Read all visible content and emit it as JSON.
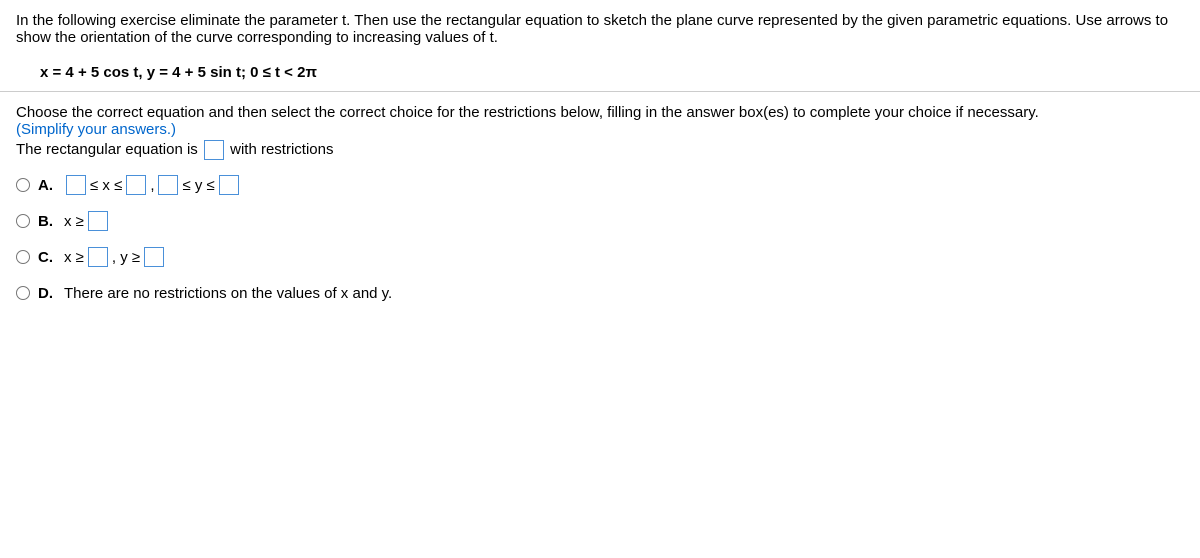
{
  "instructions": "In the following exercise eliminate the parameter t. Then use the rectangular equation to sketch the plane curve represented by the given parametric equations. Use arrows to show the orientation of the curve corresponding to increasing values of t.",
  "equation": "x = 4 + 5 cos t, y = 4 + 5 sin t; 0 ≤ t < 2π",
  "prompt": "Choose the correct equation and then select the correct choice for the restrictions below, filling in the answer box(es) to complete your choice if necessary.",
  "simplify_note": "(Simplify your answers.)",
  "rect_line_prefix": "The rectangular equation is",
  "rect_line_suffix": "with restrictions",
  "options": {
    "A": {
      "label": "A.",
      "parts": {
        "lexle": "≤ x ≤",
        "comma": ",",
        "leyle": "≤ y ≤"
      }
    },
    "B": {
      "label": "B.",
      "parts": {
        "xge": "x ≥"
      }
    },
    "C": {
      "label": "C.",
      "parts": {
        "xge": "x ≥",
        "comma_yge": ", y ≥"
      }
    },
    "D": {
      "label": "D.",
      "text": "There are no restrictions on the values of x and y."
    }
  }
}
